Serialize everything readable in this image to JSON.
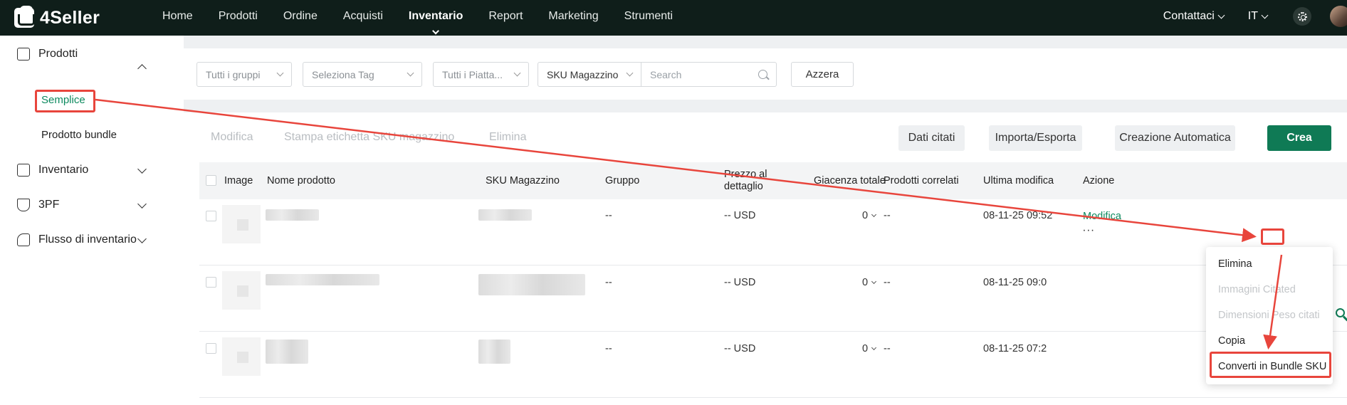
{
  "brand": {
    "name": "4Seller"
  },
  "nav": {
    "items": [
      "Home",
      "Prodotti",
      "Ordine",
      "Acquisti",
      "Inventario",
      "Report",
      "Marketing",
      "Strumenti"
    ],
    "active": "Inventario"
  },
  "topright": {
    "contact": "Contattaci",
    "language": "IT"
  },
  "sidebar": {
    "prodotti": "Prodotti",
    "semplice": "Semplice",
    "bundle": "Prodotto bundle",
    "inventario": "Inventario",
    "tpf": "3PF",
    "flusso": "Flusso di inventario"
  },
  "filters": {
    "groups": "Tutti i gruppi",
    "tags": "Seleziona Tag",
    "platforms": "Tutti i Piatta...",
    "sku_type": "SKU Magazzino",
    "search_placeholder": "Search",
    "reset": "Azzera"
  },
  "actions": {
    "edit": "Modifica",
    "print": "Stampa etichetta SKU magazzino",
    "delete": "Elimina",
    "quoted": "Dati citati",
    "import_export": "Importa/Esporta",
    "auto_create": "Creazione Automatica",
    "create": "Crea"
  },
  "table": {
    "headers": {
      "image": "Image",
      "name": "Nome prodotto",
      "sku": "SKU Magazzino",
      "group": "Gruppo",
      "price": "Prezzo al dettaglio",
      "stock": "Giacenza totale",
      "related": "Prodotti correlati",
      "modified": "Ultima modifica",
      "action": "Azione"
    },
    "rows": [
      {
        "group": "--",
        "price": "-- USD",
        "stock": "0",
        "related": "--",
        "modified": "08-11-25 09:52",
        "action": "Modifica",
        "more": "···"
      },
      {
        "group": "--",
        "price": "-- USD",
        "stock": "0",
        "related": "--",
        "modified": "08-11-25 09:0"
      },
      {
        "group": "--",
        "price": "-- USD",
        "stock": "0",
        "related": "--",
        "modified": "08-11-25 07:2"
      }
    ]
  },
  "menu": {
    "items": [
      "Elimina",
      "Immagini Citated",
      "Dimensioni Peso citati",
      "Copia",
      "Converti in Bundle SKU"
    ],
    "disabled": [
      false,
      true,
      true,
      false,
      false
    ]
  },
  "colors": {
    "topbar": "#0f1e1a",
    "accent": "#0f7a55",
    "link": "#0d8a5f",
    "highlight": "#e8453c"
  },
  "icons": [
    "logo-icon",
    "settings-icon",
    "avatar",
    "products-icon",
    "inventory-icon",
    "3pf-icon",
    "inventory-flow-icon",
    "search-icon",
    "chevron-down-icon",
    "more-icon"
  ]
}
